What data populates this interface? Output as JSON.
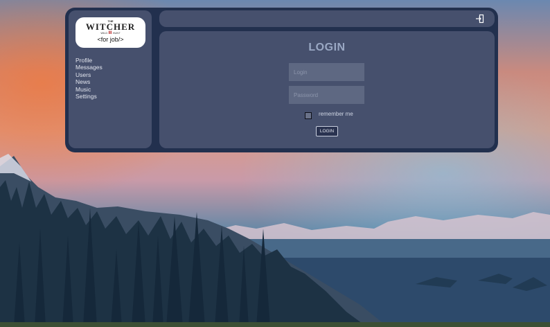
{
  "logo": {
    "the": "THE",
    "name": "WITCHER",
    "subtitle_left": "WILD",
    "subtitle_mark": "III",
    "subtitle_right": "HUNT",
    "tagline": "<for   job/>"
  },
  "sidebar": {
    "items": [
      {
        "label": "Profile"
      },
      {
        "label": "Messages"
      },
      {
        "label": "Users"
      },
      {
        "label": "News"
      },
      {
        "label": "Music"
      },
      {
        "label": "Settings"
      }
    ]
  },
  "topbar": {
    "icon": "exit-icon"
  },
  "login_form": {
    "title": "LOGIN",
    "login_placeholder": "Login",
    "login_value": "",
    "password_placeholder": "Password",
    "password_value": "",
    "remember_label": "remember me",
    "remember_checked": false,
    "submit_label": "LOGIN"
  },
  "colors": {
    "frame": "#22304e",
    "panel": "#46506d",
    "input": "#5e6882",
    "title": "#9aa8c4"
  }
}
